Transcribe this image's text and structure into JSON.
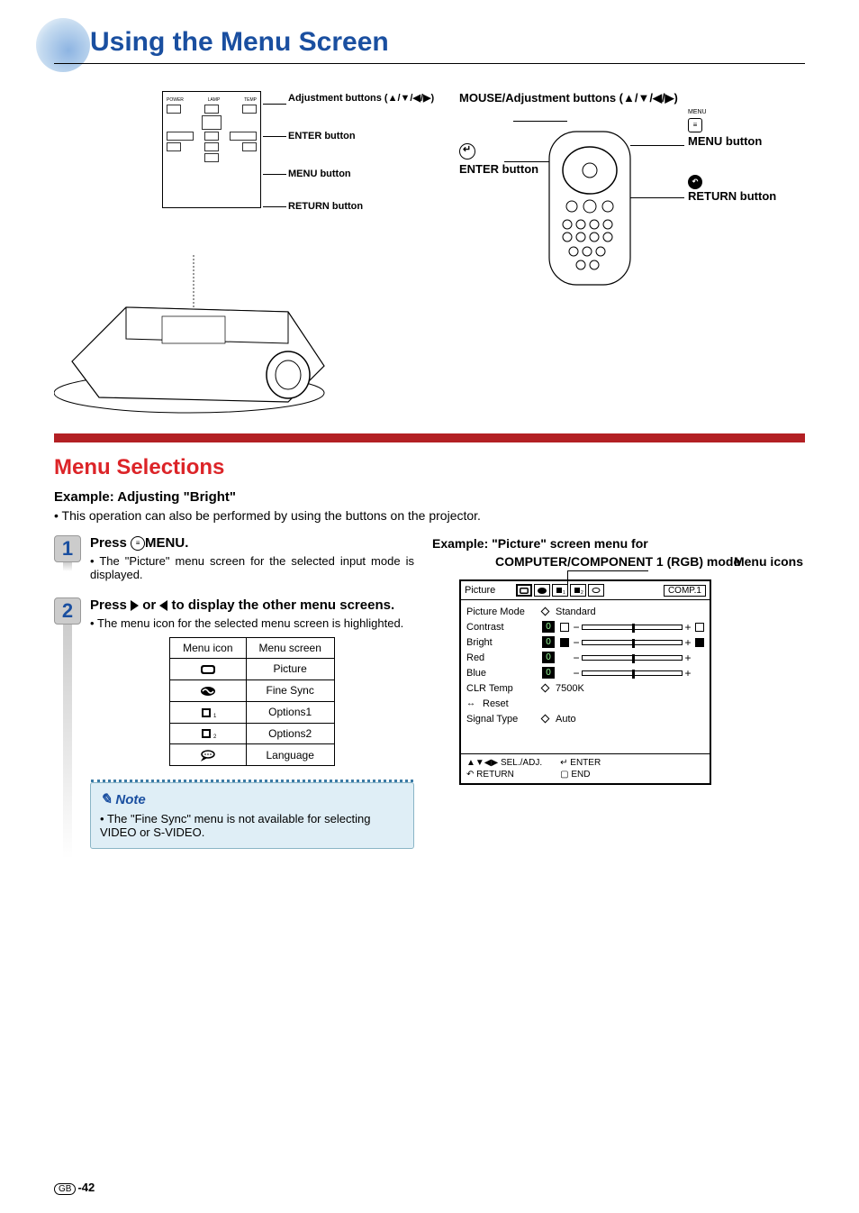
{
  "page": {
    "title": "Using the Menu Screen",
    "number": "-42",
    "region": "GB"
  },
  "projector_panel": {
    "labels": {
      "adjust": "Adjustment buttons (▲/▼/◀/▶)",
      "enter": "ENTER button",
      "menu": "MENU button",
      "return": "RETURN button"
    }
  },
  "remote": {
    "adjust_label": "MOUSE/Adjustment buttons (▲/▼/◀/▶)",
    "enter_label": "ENTER button",
    "menu_tiny": "MENU",
    "menu_label": "MENU button",
    "return_label": "RETURN button"
  },
  "section": {
    "title": "Menu Selections",
    "example": "Example: Adjusting \"Bright\"",
    "sub": "This operation can also be performed by using the buttons on the projector."
  },
  "steps": [
    {
      "num": "1",
      "title_pre": "Press ",
      "title_post": "MENU.",
      "text": "The \"Picture\" menu screen for the selected input mode is displayed."
    },
    {
      "num": "2",
      "title_pre": "Press ",
      "title_mid": " or ",
      "title_post": " to display the other menu screens.",
      "text": "The menu icon for the selected menu screen is highlighted."
    }
  ],
  "menu_table": {
    "headers": [
      "Menu icon",
      "Menu screen"
    ],
    "rows": [
      {
        "icon": "picture",
        "screen": "Picture"
      },
      {
        "icon": "finesync",
        "screen": "Fine Sync"
      },
      {
        "icon": "options1",
        "screen": "Options1"
      },
      {
        "icon": "options2",
        "screen": "Options2"
      },
      {
        "icon": "language",
        "screen": "Language"
      }
    ]
  },
  "note": {
    "title": "Note",
    "body": "The \"Fine Sync\" menu is not available for selecting VIDEO or S-VIDEO."
  },
  "screen_example": {
    "title_l1": "Example: \"Picture\" screen menu for",
    "title_l2": "COMPUTER/COMPONENT 1 (RGB) mode",
    "menu_icons_label": "Menu icons"
  },
  "osd": {
    "title": "Picture",
    "input": "COMP.1",
    "rows": [
      {
        "label": "Picture Mode",
        "type": "select",
        "value": "Standard"
      },
      {
        "label": "Contrast",
        "type": "slider",
        "value": "0"
      },
      {
        "label": "Bright",
        "type": "slider",
        "value": "0",
        "highlighted": true
      },
      {
        "label": "Red",
        "type": "slider",
        "value": "0"
      },
      {
        "label": "Blue",
        "type": "slider",
        "value": "0"
      },
      {
        "label": "CLR Temp",
        "type": "select",
        "value": "7500K"
      },
      {
        "label": "Reset",
        "type": "reset"
      },
      {
        "label": "Signal Type",
        "type": "select",
        "value": "Auto"
      }
    ],
    "footer": {
      "sel": "SEL./ADJ.",
      "return": "RETURN",
      "enter": "ENTER",
      "end": "END"
    }
  }
}
